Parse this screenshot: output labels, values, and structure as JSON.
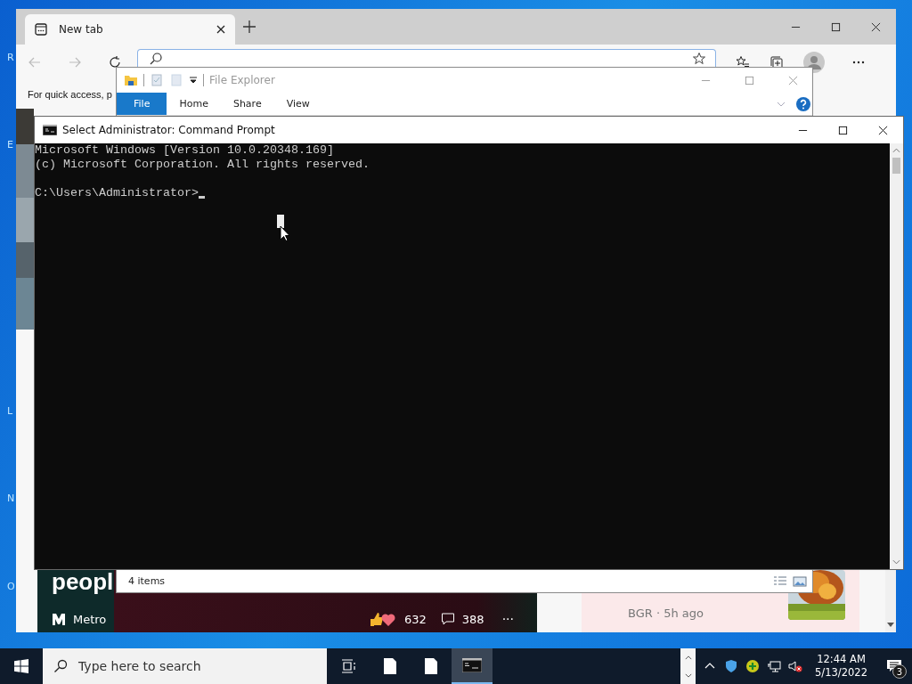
{
  "desktop": {
    "icon_labels": [
      "R",
      "E",
      "L",
      "N",
      "O"
    ]
  },
  "browser": {
    "tabs": [
      {
        "label": "New tab",
        "selected": true
      }
    ],
    "quick_access": "For quick access, p",
    "news": [
      {
        "kind": "feature",
        "headline": "peopl",
        "source": "Metro",
        "reactions": "632",
        "comments": "388",
        "more": "···"
      },
      {
        "kind": "compact",
        "source": "BGR · 5h ago"
      }
    ]
  },
  "file_explorer": {
    "title": "File Explorer",
    "ribbon_tabs": [
      {
        "label": "File",
        "selected": true
      },
      {
        "label": "Home",
        "selected": false
      },
      {
        "label": "Share",
        "selected": false
      },
      {
        "label": "View",
        "selected": false
      }
    ],
    "status": "4 items"
  },
  "command_prompt": {
    "title": "Select Administrator: Command Prompt",
    "output": [
      "Microsoft Windows [Version 10.0.20348.169]",
      "(c) Microsoft Corporation. All rights reserved."
    ],
    "prompt": "C:\\Users\\Administrator>"
  },
  "taskbar": {
    "search_placeholder": "Type here to search",
    "apps": [
      {
        "kind": "file",
        "active": false
      },
      {
        "kind": "file",
        "active": false
      },
      {
        "kind": "console",
        "active": true
      }
    ],
    "time": "12:44 AM",
    "date": "5/13/2022",
    "notifications": "3"
  }
}
